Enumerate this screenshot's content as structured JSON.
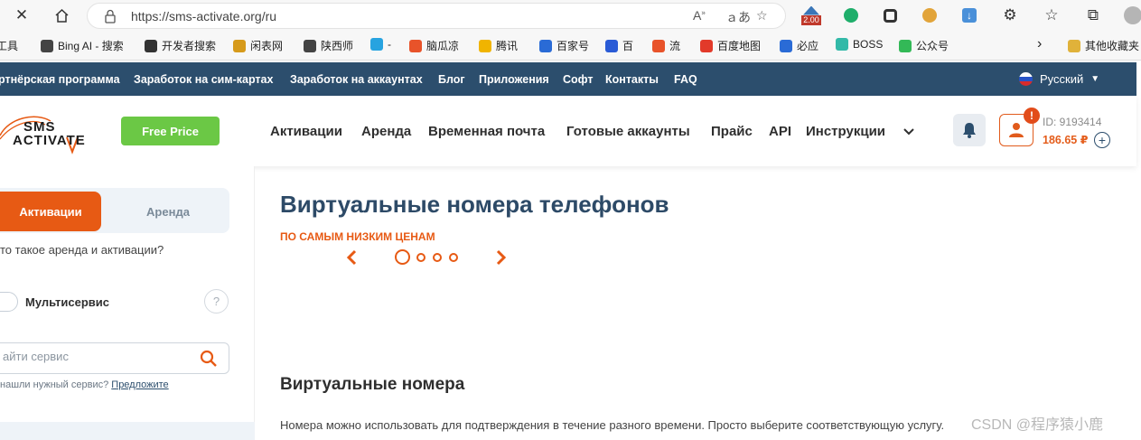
{
  "browser": {
    "url": "https://sms-activate.org/ru",
    "zoom_badge": "2.00"
  },
  "bookmarks": [
    {
      "label": "工具",
      "color": "#555555"
    },
    {
      "label": "Bing AI - 搜索",
      "color": "#444444"
    },
    {
      "label": "开发者搜索",
      "color": "#333333"
    },
    {
      "label": "闲表网",
      "color": "#d69a1a"
    },
    {
      "label": "陕西师",
      "color": "#444444"
    },
    {
      "label": "-",
      "color": "#27a3e0"
    },
    {
      "label": "脑瓜凉",
      "color": "#e8532a"
    },
    {
      "label": "腾讯",
      "color": "#f0b400"
    },
    {
      "label": "百家号",
      "color": "#2a6bd6"
    },
    {
      "label": "百",
      "color": "#2a5bd6"
    },
    {
      "label": "流",
      "color": "#e8532a"
    },
    {
      "label": "百度地图",
      "color": "#e23a2a"
    },
    {
      "label": "必应",
      "color": "#2a6bd6"
    },
    {
      "label": "BOSS",
      "color": "#33b9a8"
    },
    {
      "label": "公众号",
      "color": "#33b957"
    },
    {
      "label": "其他收藏夹",
      "color": "#e0b23a"
    }
  ],
  "topbar": {
    "links": [
      "ртнёрская программа",
      "Заработок на сим-картах",
      "Заработок на аккаунтах",
      "Блог",
      "Приложения",
      "Софт",
      "Контакты",
      "FAQ"
    ],
    "language": "Русский"
  },
  "header": {
    "logo_line1": "SMS",
    "logo_line2": "ACTIVATE",
    "free_price": "Free Price",
    "nav": [
      "Активации",
      "Аренда",
      "Временная почта",
      "Готовые аккаунты",
      "Прайс",
      "API",
      "Инструкции"
    ],
    "alert_badge": "!",
    "user_id": "ID: 9193414",
    "balance": "186.65 ₽"
  },
  "sidebar": {
    "tab_activations": "Активации",
    "tab_rent": "Аренда",
    "what_is": "то такое аренда и активации?",
    "multiservice": "Мультисервис",
    "help": "?",
    "search_placeholder": "айти сервис",
    "not_found_text": "нашли нужный сервис?",
    "not_found_link": "Предложите"
  },
  "main": {
    "title": "Виртуальные номера телефонов",
    "subtitle": "ПО САМЫМ НИЗКИМ ЦЕНАМ",
    "section_title": "Виртуальные номера",
    "section_text": "Номера можно использовать для подтверждения в течение разного времени. Просто выберите соответствующую услугу."
  },
  "watermark": "CSDN @程序猿小鹿",
  "colors": {
    "topbar_bg": "#2c4e6d",
    "accent_orange": "#e75a14",
    "free_price_green": "#6bc845",
    "title_blue": "#2d4a67"
  }
}
